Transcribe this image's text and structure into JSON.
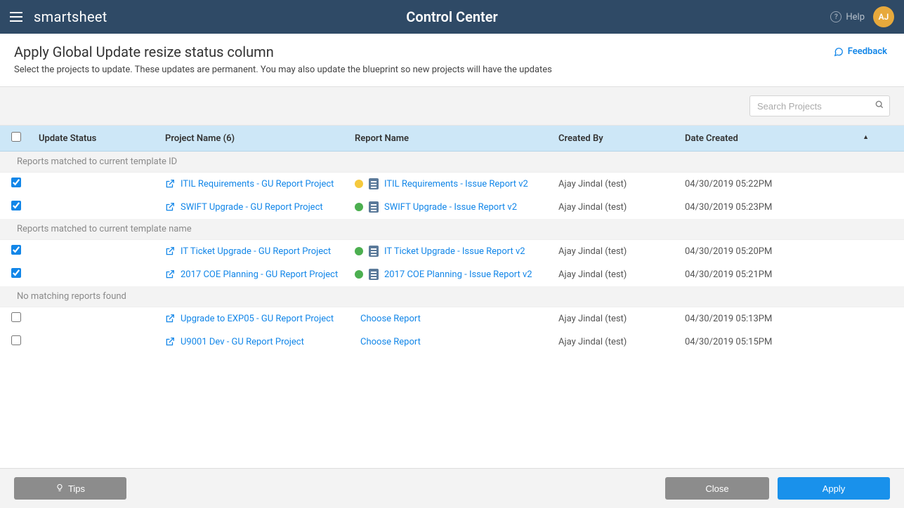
{
  "topbar": {
    "brand": "smartsheet",
    "title": "Control Center",
    "help_label": "Help",
    "avatar_initials": "AJ"
  },
  "header": {
    "title": "Apply Global Update resize status column",
    "subtitle": "Select the projects to update. These updates are permanent. You may also update the blueprint so new projects will have the updates",
    "feedback_label": "Feedback"
  },
  "search": {
    "placeholder": "Search Projects"
  },
  "columns": {
    "update_status": "Update Status",
    "project_name": "Project Name (6)",
    "report_name": "Report Name",
    "created_by": "Created By",
    "date_created": "Date Created"
  },
  "groups": {
    "template_id": "Reports matched to current template ID",
    "template_name": "Reports matched to current template name",
    "no_match": "No matching reports found"
  },
  "rows": {
    "r1": {
      "checked": true,
      "status_color": "yellow",
      "has_report": true,
      "project": "ITIL Requirements - GU Report Project",
      "report": "ITIL Requirements - Issue Report v2",
      "created_by": "Ajay Jindal (test)",
      "date": "04/30/2019 05:22PM"
    },
    "r2": {
      "checked": true,
      "status_color": "green",
      "has_report": true,
      "project": "SWIFT Upgrade - GU Report Project",
      "report": "SWIFT Upgrade - Issue Report v2",
      "created_by": "Ajay Jindal (test)",
      "date": "04/30/2019 05:23PM"
    },
    "r3": {
      "checked": true,
      "status_color": "green",
      "has_report": true,
      "project": "IT Ticket Upgrade - GU Report Project",
      "report": "IT Ticket Upgrade - Issue Report v2",
      "created_by": "Ajay Jindal (test)",
      "date": "04/30/2019 05:20PM"
    },
    "r4": {
      "checked": true,
      "status_color": "green",
      "has_report": true,
      "project": "2017 COE Planning - GU Report Project",
      "report": "2017 COE Planning - Issue Report v2",
      "created_by": "Ajay Jindal (test)",
      "date": "04/30/2019 05:21PM"
    },
    "r5": {
      "checked": false,
      "has_report": false,
      "project": "Upgrade to EXP05 - GU Report Project",
      "report": "Choose Report",
      "created_by": "Ajay Jindal (test)",
      "date": "04/30/2019 05:13PM"
    },
    "r6": {
      "checked": false,
      "has_report": false,
      "project": "U9001 Dev - GU Report Project",
      "report": "Choose Report",
      "created_by": "Ajay Jindal (test)",
      "date": "04/30/2019 05:15PM"
    }
  },
  "footer": {
    "tips": "Tips",
    "close": "Close",
    "apply": "Apply"
  }
}
